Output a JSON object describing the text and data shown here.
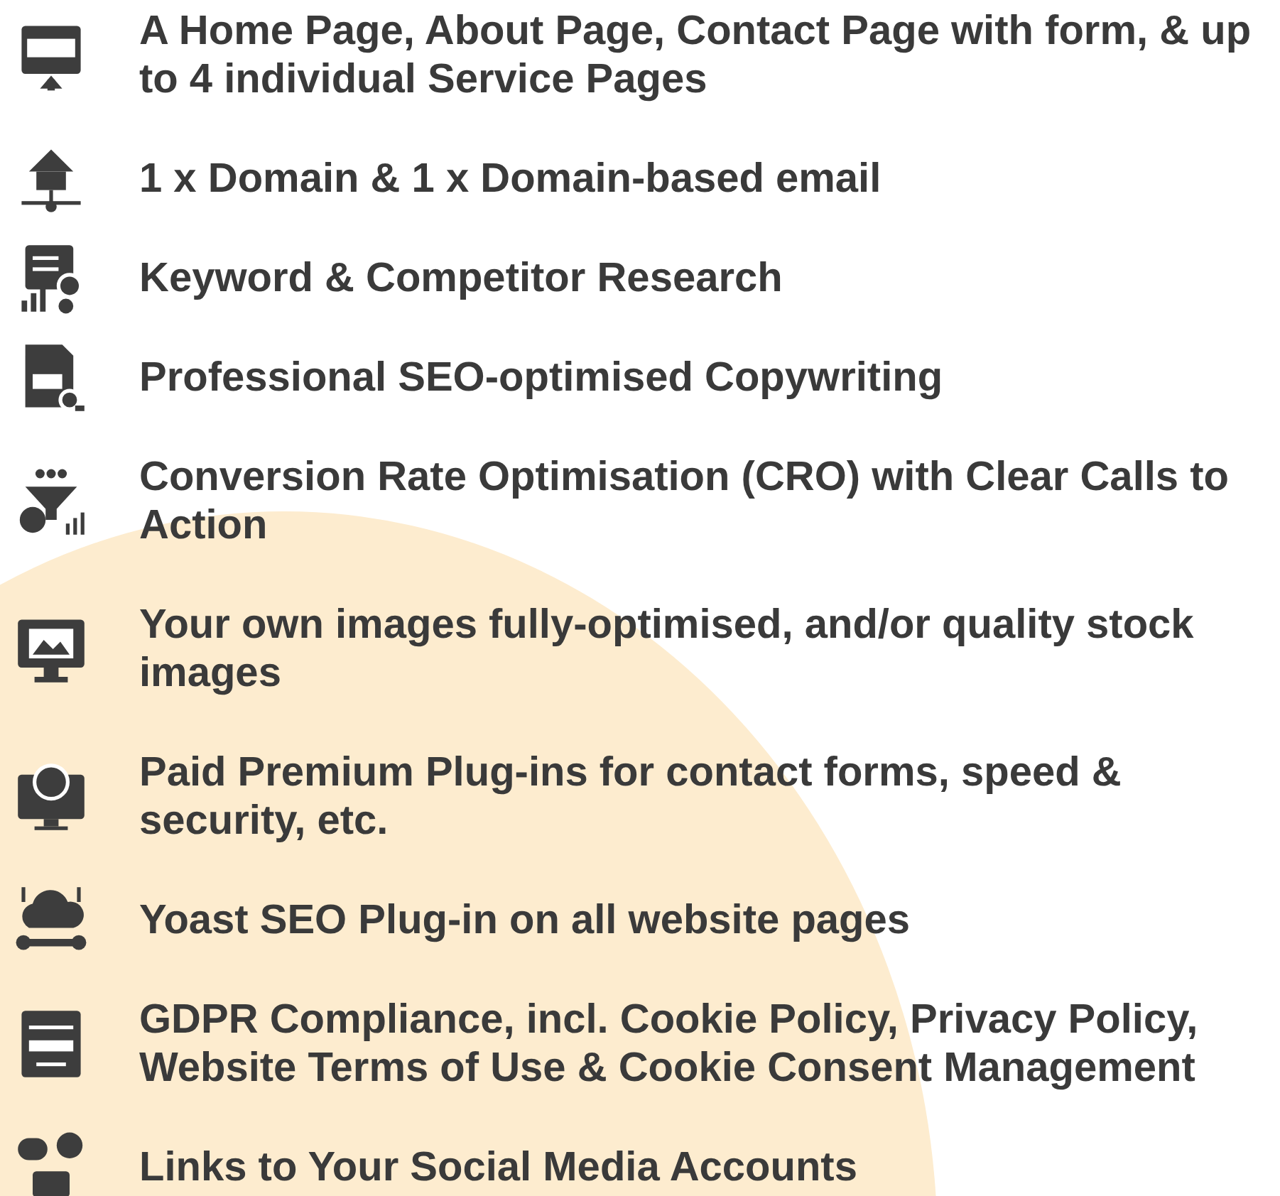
{
  "features": [
    {
      "text": "A Home Page, About Page, Contact Page with form, & up to 4 individual Service Pages"
    },
    {
      "text": "1 x Domain & 1 x Domain-based email"
    },
    {
      "text": "Keyword & Competitor Research"
    },
    {
      "text": "Professional SEO-optimised Copywriting"
    },
    {
      "text": "Conversion Rate Optimisation (CRO) with Clear Calls to Action"
    },
    {
      "text": "Your own images fully-optimised, and/or quality stock images"
    },
    {
      "text": "Paid Premium Plug-ins for contact forms, speed & security, etc."
    },
    {
      "text": "Yoast SEO Plug-in on all website pages"
    },
    {
      "text": "GDPR Compliance, incl. Cookie Policy, Privacy Policy, Website Terms of Use & Cookie Consent Management"
    },
    {
      "text": "Links to Your Social Media Accounts"
    }
  ]
}
